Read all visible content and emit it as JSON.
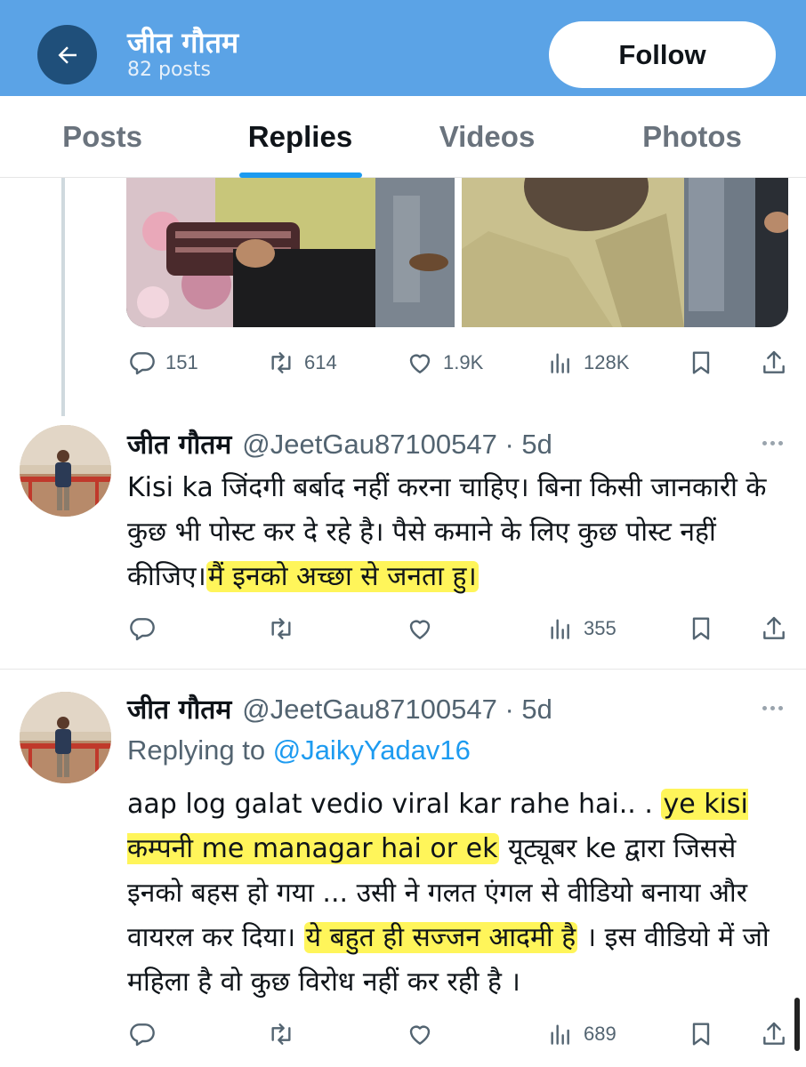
{
  "header": {
    "name": "जीत गौतम",
    "post_count": "82 posts",
    "follow_label": "Follow"
  },
  "tabs": [
    {
      "label": "Posts",
      "active": false
    },
    {
      "label": "Replies",
      "active": true
    },
    {
      "label": "Videos",
      "active": false
    },
    {
      "label": "Photos",
      "active": false
    }
  ],
  "colors": {
    "header_bg": "#5ba3e6",
    "accent": "#1d9bf0",
    "highlight": "#fff55a"
  },
  "original_post": {
    "stats": {
      "replies": "151",
      "reposts": "614",
      "likes": "1.9K",
      "views": "128K"
    }
  },
  "tweets": [
    {
      "name": "जीत गौतम",
      "handle_time": "@JeetGau87100547 · 5d",
      "body": {
        "plain1": "Kisi ka जिंदगी बर्बाद नहीं करना चाहिए। बिना किसी जानकारी के कुछ भी पोस्ट कर दे रहे है। पैसे कमाने के लिए कुछ पोस्ट नहीं कीजिए।",
        "highlight1": "मैं इनको अच्छा से जनता हु।"
      },
      "stats": {
        "views": "355"
      }
    },
    {
      "name": "जीत गौतम",
      "handle_time": "@JeetGau87100547 · 5d",
      "replying_prefix": "Replying to",
      "replying_to": "@JaikyYadav16",
      "body": {
        "plain1": "aap log galat vedio viral kar rahe hai.. .",
        "highlight1": "ye kisi कम्पनी me managar hai or ek",
        "plain2": "यूट्यूबर ke द्वारा जिससे इनको बहस हो गया ... उसी ने गलत एंगल से वीडियो बनाया और वायरल कर दिया।",
        "highlight2": "ये बहुत ही सज्जन आदमी है",
        "plain3": "। इस वीडियो में जो महिला है वो कुछ विरोध नहीं कर रही है ।"
      },
      "stats": {
        "views": "689"
      }
    }
  ],
  "icons": [
    "back-arrow-icon",
    "reply-icon",
    "repost-icon",
    "like-icon",
    "views-icon",
    "bookmark-icon",
    "share-icon",
    "more-icon"
  ]
}
